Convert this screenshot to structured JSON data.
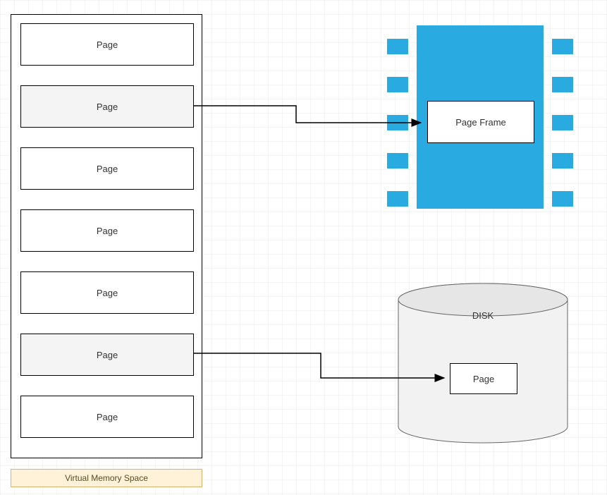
{
  "vm": {
    "label": "Virtual Memory Space",
    "pages": [
      "Page",
      "Page",
      "Page",
      "Page",
      "Page",
      "Page",
      "Page"
    ]
  },
  "ram": {
    "page_frame_label": "Page Frame"
  },
  "disk": {
    "label": "DISK",
    "page_label": "Page"
  }
}
